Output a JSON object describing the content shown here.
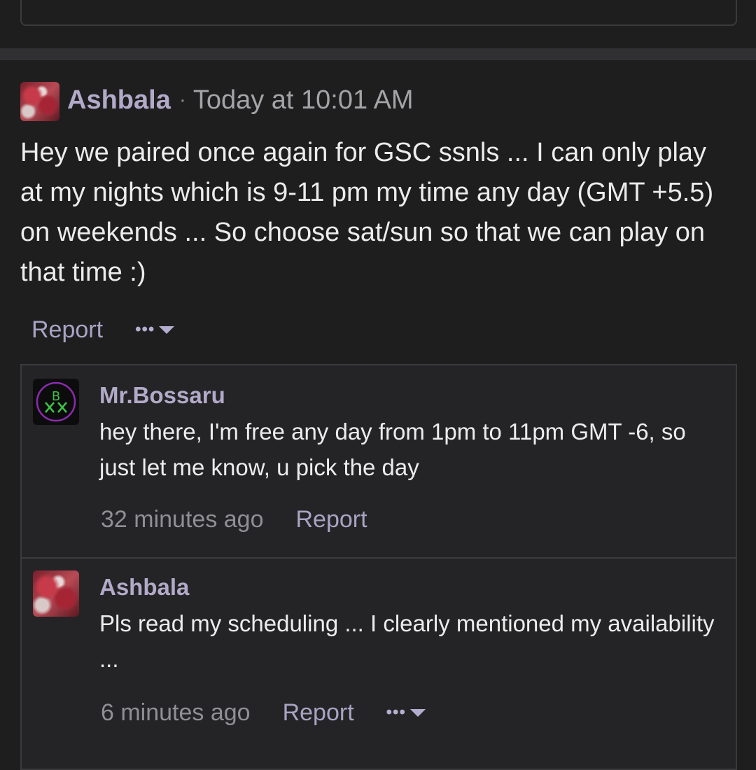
{
  "main_comment": {
    "author": "Ashbala",
    "separator": "·",
    "timestamp": "Today at 10:01 AM",
    "body": "Hey we paired once again for GSC ssnls ... I can only play at my nights which is 9-11 pm my time any day (GMT +5.5) on weekends ... So choose sat/sun so that we can play on that time :)",
    "report_label": "Report",
    "more_label": "•••"
  },
  "replies": [
    {
      "author": "Mr.Bossaru",
      "body": "hey there, I'm free any day from 1pm to 11pm GMT -6, so just let me know, u pick the day",
      "timestamp": "32 minutes ago",
      "report_label": "Report"
    },
    {
      "author": "Ashbala",
      "body": "Pls read my scheduling ... I clearly mentioned my availability ...",
      "timestamp": "6 minutes ago",
      "report_label": "Report",
      "more_label": "•••"
    }
  ],
  "colors": {
    "background": "#1e1e1f",
    "username": "#b2aac8",
    "link": "#a8a4c4",
    "reply_panel": "#242426",
    "border": "#3b3b3d"
  },
  "icons": {
    "more": "ellipsis-icon",
    "dropdown": "caret-down-icon",
    "avatar_bossaru_monogram": "MB"
  }
}
